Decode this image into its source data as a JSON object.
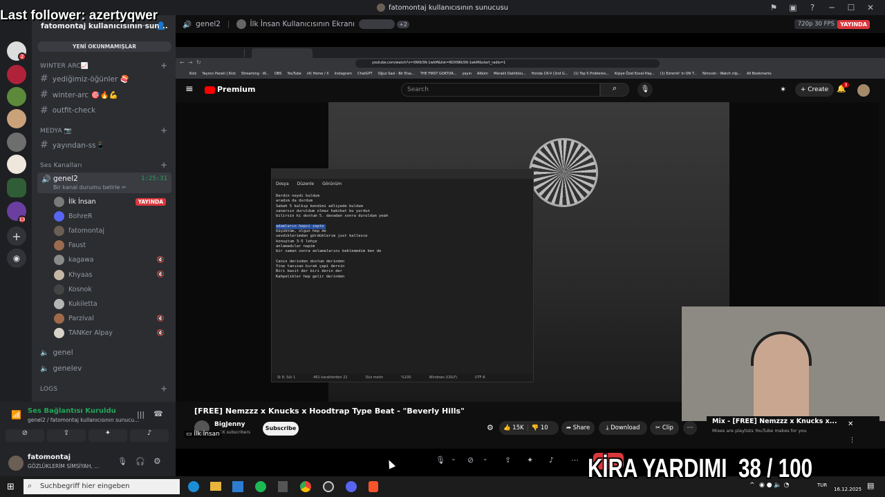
{
  "window": {
    "title": "fatomontaj kullanıcısının sunucusu"
  },
  "overlay": {
    "last_follower": "Last follower: azertyqwer",
    "counter": "KİRA YARDIMI  38 / 100"
  },
  "server": {
    "name": "fatomontaj kullanıcısının sun...",
    "unread_banner": "YENİ OKUNMAMIŞLAR"
  },
  "categories": {
    "winter": "WINTER ARC📈",
    "medya": "MEDYA 📷",
    "ses": "Ses Kanalları",
    "logs": "LOGS"
  },
  "text_channels": [
    "yediğimiz-öğünler 🍣",
    "winter-arc 🎯🔥💪",
    "outfit-check",
    "yayından-ss📱"
  ],
  "voice": {
    "active_channel": "genel2",
    "active_status": "Bir kanal durumu belirle ✏",
    "timer": "1:25:31",
    "users": [
      {
        "name": "İlk İnsan",
        "badge": "YAYINDA"
      },
      {
        "name": "BohreR"
      },
      {
        "name": "fatomontaj"
      },
      {
        "name": "Faust"
      },
      {
        "name": "kagawa"
      },
      {
        "name": "Khyaas"
      },
      {
        "name": "Kosnok"
      },
      {
        "name": "Kukiletta"
      },
      {
        "name": "Parzival"
      },
      {
        "name": "TANKer Alpay"
      }
    ],
    "other_channels": [
      "genel",
      "genelev"
    ]
  },
  "voice_connection": {
    "status": "Ses Bağlantısı Kuruldu",
    "detail": "genel2 / fatomontaj kullanıcısının sunucu..."
  },
  "user": {
    "name": "fatomontaj",
    "status": "GÖZLÜKLERİM SİMSİYAH, ..."
  },
  "stream_header": {
    "channel": "genel2",
    "screen_name": "İlk İnsan Kullanıcısının Ekranı",
    "more": "+2",
    "quality": "720p 30 FPS",
    "live": "YAYINDA"
  },
  "browser": {
    "url": "youtube.com/watch?v=XNKk5N-1wkM&list=RDXNKk5N-1wkM&start_radio=1",
    "bookmarks": [
      "Kick",
      "Yayıncı Paneli | Kick",
      "Streaming - W...",
      "OBS",
      "YouTube",
      "(4) Home / X",
      "Instagram",
      "ChatGPT",
      "Oğuz Sasi - Bir Elsa...",
      "THE FIRST GOKTUR...",
      "yayın",
      "Albüm",
      "Meraklı Daktilolu...",
      "Honda CR-V (2nd G...",
      "(1) Top 5 Problems...",
      "Kişiye Özel Excel-Hay...",
      "(1) Ezremit' in ON T...",
      "Nimcoin - Watch clip...",
      "All Bookmarks"
    ],
    "search_placeholder": "Search",
    "create": "Create",
    "notif_count": "3"
  },
  "notepad": {
    "menu": [
      "Dosya",
      "Düzenle",
      "Görünüm"
    ],
    "lines": [
      "Derdin neydi buldum",
      "aradım da durdum",
      "Sabah 5 kalkıp kendimi adliyede buldum",
      "sanarsın duruldum olmaz hakikat bu yurdun",
      "bilirsin ki dostum 5. davadan sonra duruldum yeah",
      "",
      "adamların hepsi zapte",
      "küçüktüm, olgun hep de",
      "sevdiklerimden gördüklerim just kallesce",
      "konuştum 3-5 lehçe",
      "anlamadılar napim",
      "bir zaman sonra anlamalarını beklemedim ben de",
      "",
      "Canın derinden dostum derinden",
      "Yine tanısan bırak çapi dersin",
      "Biri basit der biri derin der",
      "Kahpelikler hep gelir derinden"
    ],
    "status": [
      "St 8, Süt 1",
      "461 karakterden 22",
      "Düz metin",
      "%100",
      "Windows (CRLF)",
      "UTF-8"
    ]
  },
  "video": {
    "title": "[FREE] Nemzzz x Knucks x Hoodtrap Type Beat - \"Beverly Hills\"",
    "channel": "BigJenny",
    "subs": "1K subscribers",
    "subscribe": "Subscribe",
    "likes": "15K",
    "dislikes": "10",
    "share": "Share",
    "download": "Download",
    "clip": "Clip",
    "viewer_label": "İlk İnsan",
    "mix_title": "Mix - [FREE] Nemzzz x Knucks x...",
    "mix_sub": "Mixes are playlists YouTube makes for you"
  },
  "taskbar": {
    "search": "Suchbegriff hier eingeben",
    "lang": "TUR",
    "date": "16.12.2025"
  }
}
